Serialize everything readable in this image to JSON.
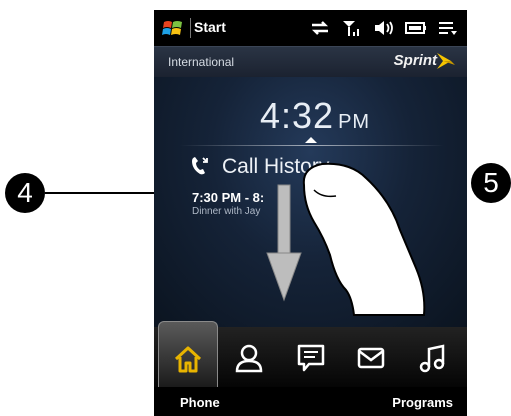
{
  "callouts": {
    "left": "4",
    "right": "5"
  },
  "status_bar": {
    "start_label": "Start",
    "icons": [
      "windows-logo-icon",
      "data-sync-icon",
      "signal-icon",
      "speaker-icon",
      "battery-icon",
      "menu-icon"
    ]
  },
  "carrier_bar": {
    "region": "International",
    "carrier": "Sprint"
  },
  "home": {
    "time": "4:32",
    "ampm": "PM",
    "call_history_label": "Call History",
    "entry_time": "7:30 PM - 8:",
    "entry_desc": "Dinner with Jay"
  },
  "tabs": [
    "home-icon",
    "people-icon",
    "messages-icon",
    "mail-icon",
    "music-icon"
  ],
  "softkeys": {
    "left": "Phone",
    "right": "Programs"
  },
  "colors": {
    "screen_bg": "#0b1420",
    "tab_selected_icon": "#e8b400",
    "sprint_yellow": "#f5c400"
  }
}
